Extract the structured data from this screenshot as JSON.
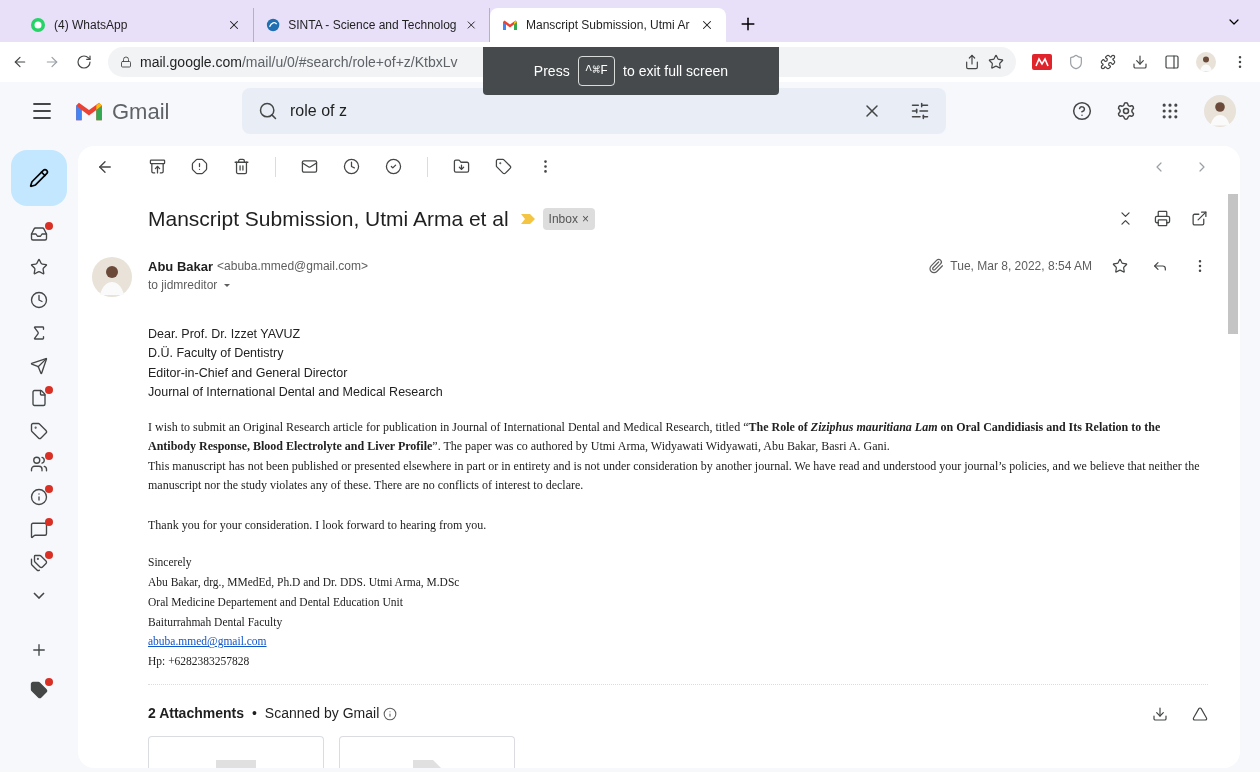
{
  "browser": {
    "tabs": [
      {
        "title": "(4) WhatsApp",
        "selected": false,
        "kind": "whatsapp"
      },
      {
        "title": "SINTA - Science and Technolog",
        "selected": false,
        "kind": "sinta"
      },
      {
        "title": "Manscript Submission, Utmi Ar",
        "selected": true,
        "kind": "gmail"
      }
    ],
    "url_host": "mail.google.com",
    "url_path": "/mail/u/0/#search/role+of+z/KtbxLv",
    "fullscreen_notice": {
      "before": "Press",
      "key": "^⌘F",
      "after": "to exit full screen"
    }
  },
  "app": {
    "name": "Gmail",
    "search": {
      "value": "role of z"
    }
  },
  "sidebar": {
    "items": [
      {
        "kind": "inbox",
        "badge": true
      },
      {
        "kind": "star",
        "badge": false
      },
      {
        "kind": "clock",
        "badge": false
      },
      {
        "kind": "sigma",
        "badge": false
      },
      {
        "kind": "send",
        "badge": false
      },
      {
        "kind": "file",
        "badge": true
      },
      {
        "kind": "label",
        "badge": false
      },
      {
        "kind": "people",
        "badge": true
      },
      {
        "kind": "info",
        "badge": true
      },
      {
        "kind": "forum",
        "badge": true
      },
      {
        "kind": "tag",
        "badge": true
      },
      {
        "kind": "more",
        "badge": false
      }
    ],
    "bottom": [
      {
        "kind": "plus",
        "badge": false
      },
      {
        "kind": "label-filled",
        "badge": true
      }
    ]
  },
  "message": {
    "subject": "Manscript Submission, Utmi Arma et al",
    "label": "Inbox",
    "label_close": "×",
    "sender_name": "Abu Bakar",
    "sender_email": "<abuba.mmed@gmail.com>",
    "to": "to jidmreditor",
    "date": "Tue, Mar 8, 2022, 8:54 AM",
    "address": [
      "Dear. Prof. Dr. Izzet YAVUZ",
      "D.Ü. Faculty of Dentistry",
      "Editor-in-Chief and General Director",
      "Journal of International Dental and Medical Research"
    ],
    "paragraphs": [
      "I wish to submit an Original Research article for publication in Journal of International Dental and Medical Research, titled “**The Role of** *Ziziphus mauritiana Lam* **on Oral Candidiasis and Its Relation to the Antibody Response, Blood Electrolyte and Liver Profile**”. The paper was co authored by Utmi Arma, Widyawati Widyawati, Abu Bakar, Basri A. Gani.",
      "This manuscript has not been published or presented elsewhere in part or in entirety and is not under consideration by another journal. We have read and understood your journal’s policies, and we believe that neither the manuscript nor the study violates any of these. There are no conflicts of interest to declare.",
      "Thank you for your consideration. I look forward to hearing from you."
    ],
    "signature": [
      "Sincerely",
      "Abu Bakar, drg., MMedEd, Ph.D and Dr. DDS. Utmi Arma, M.DSc",
      "Oral Medicine Departement and Dental Education Unit",
      "Baiturrahmah Dental Faculty"
    ],
    "signature_link": "abuba.mmed@gmail.com",
    "phone": "Hp: +6282383257828",
    "attachments": {
      "title": "2 Attachments",
      "separator": "•",
      "scanned": "Scanned by Gmail",
      "files": [
        {
          "kind": "image"
        },
        {
          "kind": "document"
        }
      ]
    }
  }
}
